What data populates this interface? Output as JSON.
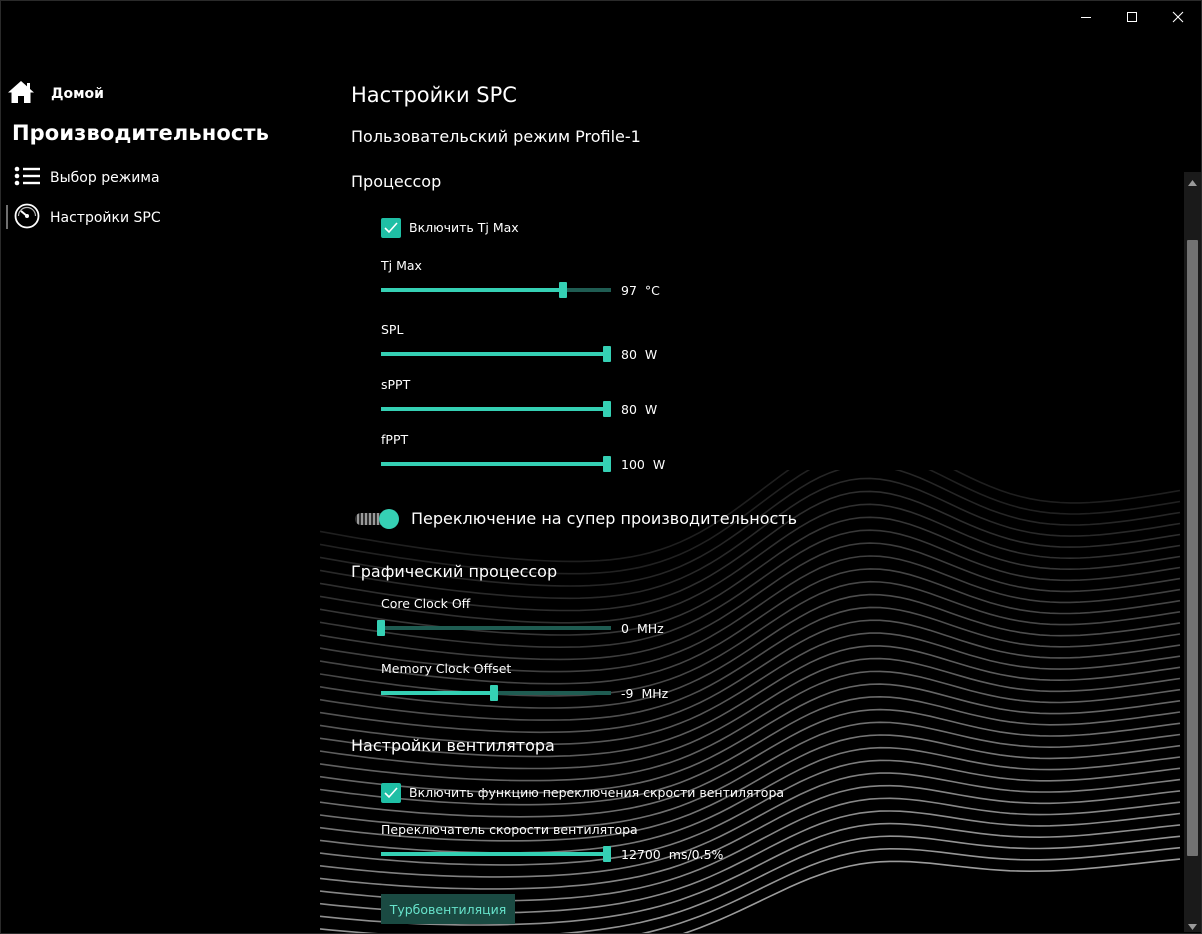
{
  "window": {
    "minimize_icon": "minimize-icon",
    "maximize_icon": "maximize-icon",
    "close_icon": "close-icon"
  },
  "sidebar": {
    "home": {
      "label": "Домой",
      "icon": "home-icon"
    },
    "section_title": "Производительность",
    "items": [
      {
        "label": "Выбор режима",
        "icon": "list-icon"
      },
      {
        "label": "Настройки SPC",
        "icon": "gauge-icon",
        "selected": true
      }
    ]
  },
  "main": {
    "title": "Настройки SPC",
    "subtitle": "Пользовательский режим Profile-1",
    "cpu": {
      "title": "Процессор",
      "tjmax_checkbox": {
        "label": "Включить Tj Max",
        "checked": true
      },
      "sliders": [
        {
          "label": "Tj Max",
          "value": "97",
          "unit": "°C",
          "fraction": 0.79
        },
        {
          "label": "SPL",
          "value": "80",
          "unit": "W",
          "fraction": 1.0
        },
        {
          "label": "sPPT",
          "value": "80",
          "unit": "W",
          "fraction": 1.0
        },
        {
          "label": "fPPT",
          "value": "100",
          "unit": "W",
          "fraction": 1.0
        }
      ]
    },
    "super_performance": {
      "label": "Переключение на супер производительность",
      "on": true
    },
    "gpu": {
      "title": "Графический процессор",
      "sliders": [
        {
          "label": "Core Clock Off",
          "value": "0",
          "unit": "MHz",
          "fraction": 0.0
        },
        {
          "label": "Memory Clock Offset",
          "value": "-9",
          "unit": "MHz",
          "fraction": 0.49
        }
      ]
    },
    "fan": {
      "title": "Настройки вентилятора",
      "checkbox": {
        "label": "Включить функцию переключения скрости вентилятора",
        "checked": true
      },
      "slider": {
        "label": "Переключатель скорости вентилятора",
        "value": "12700",
        "unit": "ms/0.5%",
        "fraction": 1.0
      },
      "turbo_button": "Турбовентиляция"
    }
  },
  "colors": {
    "background": "#000000",
    "accent": "#35d0b4",
    "accent_dark": "#1f5c52",
    "button_bg": "#1a4a42",
    "button_text": "#67e3cb"
  }
}
